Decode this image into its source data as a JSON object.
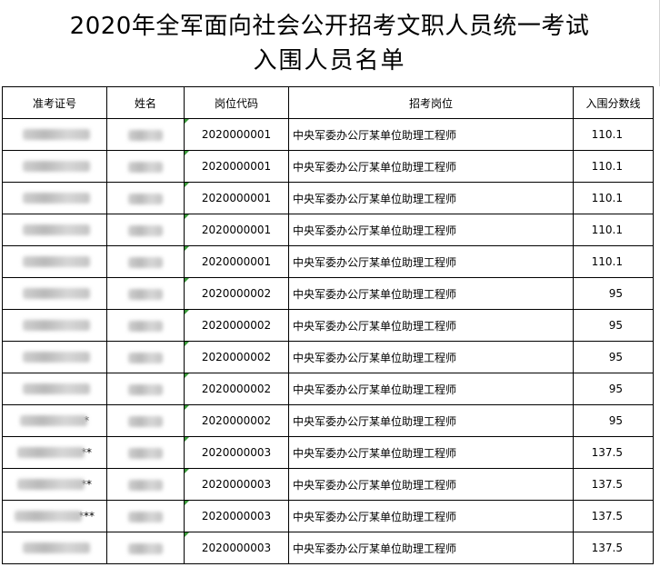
{
  "title": {
    "line1": "2020年全军面向社会公开招考文职人员统一考试",
    "line2": "入围人员名单"
  },
  "columns": [
    "准考证号",
    "姓名",
    "岗位代码",
    "招考岗位",
    "入围分数线"
  ],
  "rows": [
    {
      "id_mask": "",
      "code": "2020000001",
      "post": "中央军委办公厅某单位助理工程师",
      "score": "110.1"
    },
    {
      "id_mask": "",
      "code": "2020000001",
      "post": "中央军委办公厅某单位助理工程师",
      "score": "110.1"
    },
    {
      "id_mask": "",
      "code": "2020000001",
      "post": "中央军委办公厅某单位助理工程师",
      "score": "110.1"
    },
    {
      "id_mask": "",
      "code": "2020000001",
      "post": "中央军委办公厅某单位助理工程师",
      "score": "110.1"
    },
    {
      "id_mask": "",
      "code": "2020000001",
      "post": "中央军委办公厅某单位助理工程师",
      "score": "110.1"
    },
    {
      "id_mask": "",
      "code": "2020000002",
      "post": "中央军委办公厅某单位助理工程师",
      "score": "95"
    },
    {
      "id_mask": "",
      "code": "2020000002",
      "post": "中央军委办公厅某单位助理工程师",
      "score": "95"
    },
    {
      "id_mask": "",
      "code": "2020000002",
      "post": "中央军委办公厅某单位助理工程师",
      "score": "95"
    },
    {
      "id_mask": "",
      "code": "2020000002",
      "post": "中央军委办公厅某单位助理工程师",
      "score": "95"
    },
    {
      "id_mask": "*",
      "code": "2020000002",
      "post": "中央军委办公厅某单位助理工程师",
      "score": "95"
    },
    {
      "id_mask": "**",
      "code": "2020000003",
      "post": "中央军委办公厅某单位助理工程师",
      "score": "137.5"
    },
    {
      "id_mask": "**",
      "code": "2020000003",
      "post": "中央军委办公厅某单位助理工程师",
      "score": "137.5"
    },
    {
      "id_mask": "***",
      "code": "2020000003",
      "post": "中央军委办公厅某单位助理工程师",
      "score": "137.5"
    },
    {
      "id_mask": "",
      "code": "2020000003",
      "post": "中央军委办公厅某单位助理工程师",
      "score": "137.5"
    }
  ]
}
